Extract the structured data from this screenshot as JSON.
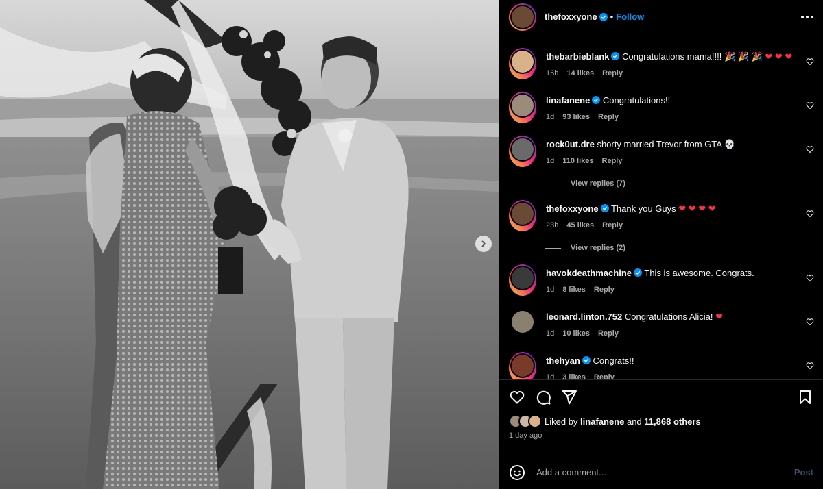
{
  "post": {
    "author": "thefoxxyone",
    "follow_label": "Follow",
    "dot": "•",
    "photo_alt": "Black and white photo of a beach wedding ceremony"
  },
  "comments": [
    {
      "user": "thebarbieblank",
      "verified": true,
      "text": "Congratulations mama!!!! 🎉 🎉 🎉",
      "hearts": "❤ ❤ ❤",
      "time": "16h",
      "likes": "14 likes",
      "reply": "Reply",
      "avatar_color": "#d9b28a",
      "ring": true
    },
    {
      "user": "linafanene",
      "verified": true,
      "text": "Congratulations!!",
      "hearts": "",
      "time": "1d",
      "likes": "93 likes",
      "reply": "Reply",
      "avatar_color": "#9c8a7a",
      "ring": true
    },
    {
      "user": "rock0ut.dre",
      "verified": false,
      "text": "shorty married Trevor from GTA 💀",
      "hearts": "",
      "time": "1d",
      "likes": "110 likes",
      "reply": "Reply",
      "avatar_color": "#6a6a6a",
      "ring": true,
      "view_replies": "View replies (7)"
    },
    {
      "user": "thefoxxyone",
      "verified": true,
      "text": "Thank you Guys",
      "hearts": "❤ ❤ ❤ ❤",
      "time": "23h",
      "likes": "45 likes",
      "reply": "Reply",
      "avatar_color": "#6b4a35",
      "ring": true,
      "view_replies": "View replies (2)"
    },
    {
      "user": "havokdeathmachine",
      "verified": true,
      "text": "This is awesome. Congrats.",
      "hearts": "",
      "time": "1d",
      "likes": "8 likes",
      "reply": "Reply",
      "avatar_color": "#3a3a3a",
      "ring": true
    },
    {
      "user": "leonard.linton.752",
      "verified": false,
      "text": "Congratulations Alicia!",
      "hearts": "❤",
      "time": "1d",
      "likes": "10 likes",
      "reply": "Reply",
      "avatar_color": "#8a8070",
      "ring": false
    },
    {
      "user": "thehyan",
      "verified": true,
      "text": "Congrats!!",
      "hearts": "",
      "time": "1d",
      "likes": "3 likes",
      "reply": "Reply",
      "avatar_color": "#7a3a2a",
      "ring": true
    }
  ],
  "likes_summary": {
    "prefix": "Liked by",
    "user": "linafanene",
    "joiner": "and",
    "others": "11,868 others"
  },
  "date": "1 day ago",
  "add_comment": {
    "placeholder": "Add a comment...",
    "post_label": "Post"
  },
  "colors": {
    "accent": "#0095f6",
    "heart": "#ff3040",
    "muted": "#a8a8a8",
    "verified": "#0095f6"
  }
}
